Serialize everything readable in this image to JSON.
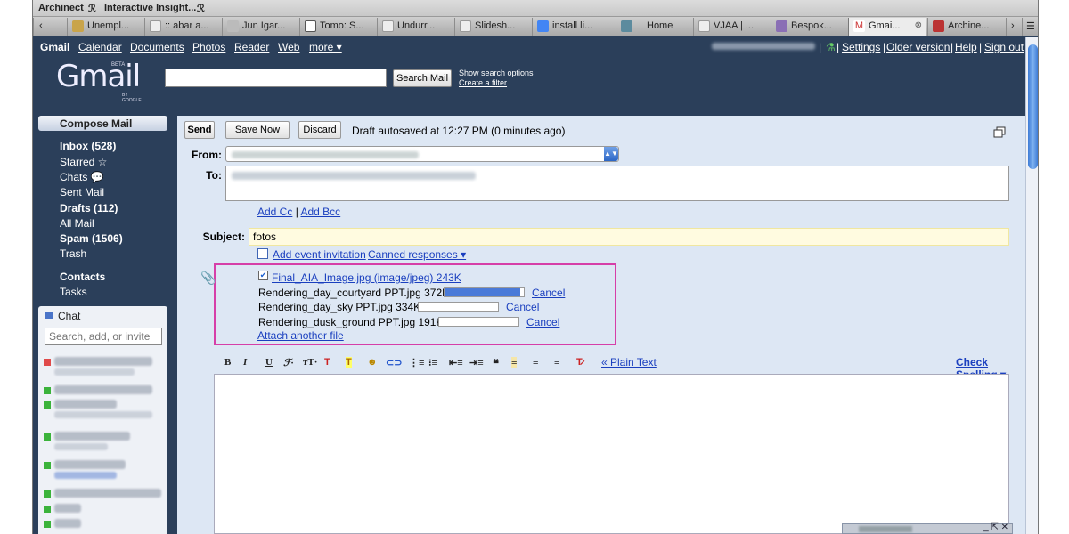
{
  "bookmarks": [
    "Archinect",
    "Interactive Insight..."
  ],
  "tabs": [
    "Unempl...",
    ":: abar a...",
    "Jun Igar...",
    "Tomo: S...",
    "Undurr...",
    "Slidesh...",
    "install li...",
    "Home",
    "VJAA | ...",
    "Bespok...",
    "Gmai...",
    "Archine..."
  ],
  "nav": {
    "brand": "Gmail",
    "links": [
      "Calendar",
      "Documents",
      "Photos",
      "Reader",
      "Web",
      "more ▾"
    ],
    "settings": "Settings",
    "older": "Older version",
    "help": "Help",
    "signout": "Sign out"
  },
  "header": {
    "logo": "Gmail",
    "beta": "BETA",
    "by": "BY GOOGLE",
    "search_button": "Search Mail",
    "show_options": "Show search options",
    "create_filter": "Create a filter"
  },
  "sidebar": {
    "compose": "Compose Mail",
    "items": [
      {
        "label": "Inbox (528)"
      },
      {
        "label": "Starred ☆"
      },
      {
        "label": "Chats 💬"
      },
      {
        "label": "Sent Mail"
      },
      {
        "label": "Drafts (112)"
      },
      {
        "label": "All Mail"
      },
      {
        "label": "Spam (1506)"
      },
      {
        "label": "Trash"
      },
      {
        "label": "Contacts"
      },
      {
        "label": "Tasks"
      }
    ],
    "chat_title": "Chat",
    "chat_placeholder": "Search, add, or invite"
  },
  "compose": {
    "send": "Send",
    "save_now": "Save Now",
    "discard": "Discard",
    "autosave": "Draft autosaved at 12:27 PM (0 minutes ago)",
    "from_label": "From:",
    "to_label": "To:",
    "add_cc": "Add Cc",
    "add_bcc": "Add Bcc",
    "subject_label": "Subject:",
    "subject_value": "fotos",
    "add_event": "Add event invitation",
    "canned": "Canned responses ▾",
    "attachment_main": "Final_AIA_Image.jpg (image/jpeg) 243K",
    "uploads": [
      {
        "name": "Rendering_day_courtyard PPT.jpg 372K",
        "progress": 0.95,
        "cancel": "Cancel"
      },
      {
        "name": "Rendering_day_sky PPT.jpg 334K",
        "progress": 0.0,
        "cancel": "Cancel"
      },
      {
        "name": "Rendering_dusk_ground PPT.jpg 191K",
        "progress": 0.0,
        "cancel": "Cancel"
      }
    ],
    "attach_another": "Attach another file",
    "plain_text": "« Plain Text",
    "check_spelling": "Check Spelling ▾"
  },
  "colors": {
    "page_bg": "#2b3f5a",
    "panel_bg": "#dde7f4",
    "highlight_border": "#d63fa8",
    "link": "#1a3fbf"
  }
}
